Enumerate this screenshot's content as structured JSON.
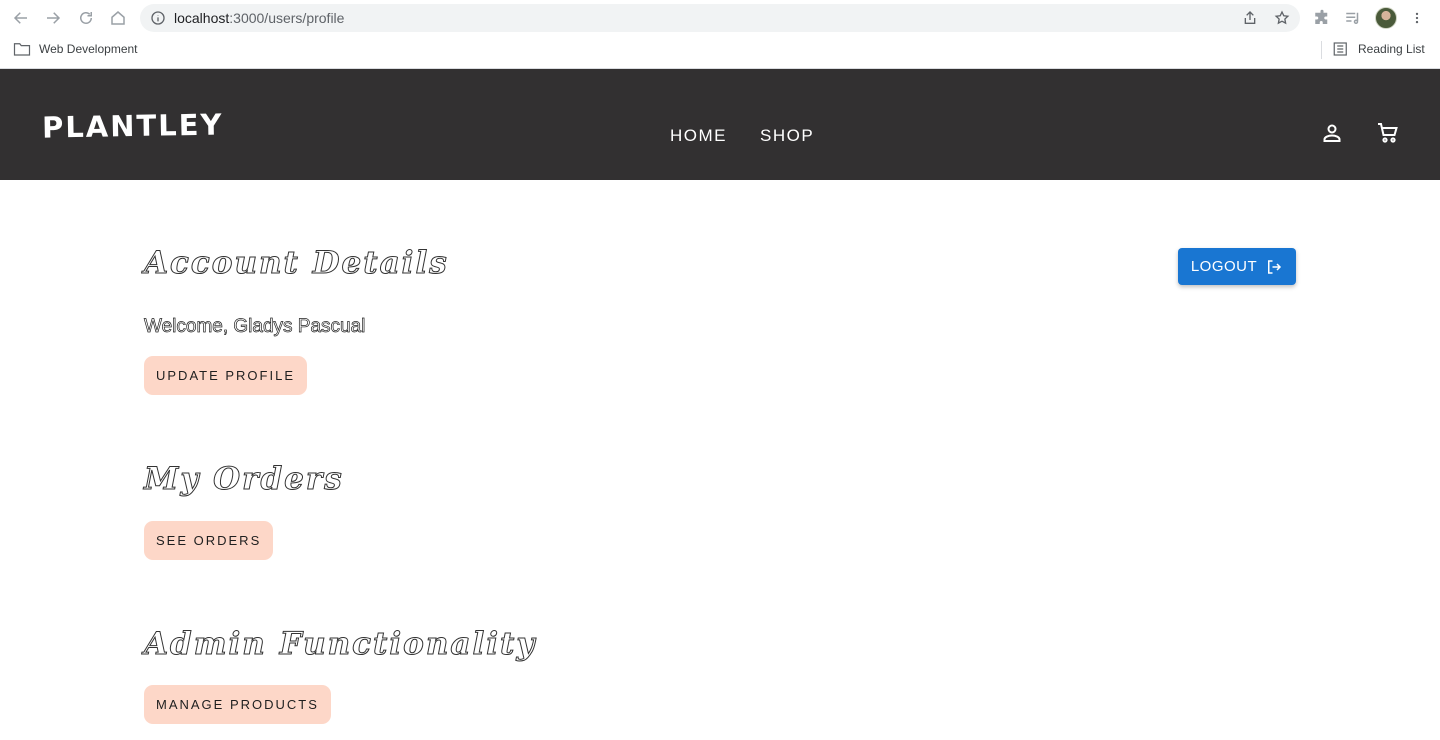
{
  "browser": {
    "url_host": "localhost",
    "url_path": ":3000/users/profile",
    "bookmarks": {
      "web_development": "Web Development",
      "reading_list": "Reading List"
    }
  },
  "header": {
    "logo": "PLANTLEY",
    "nav": {
      "home": "HOME",
      "shop": "SHOP"
    },
    "icons": [
      "user-icon",
      "cart-icon"
    ]
  },
  "account": {
    "title": "Account Details",
    "welcome": "Welcome, Gladys Pascual",
    "update_profile": "UPDATE PROFILE",
    "logout": "LOGOUT"
  },
  "orders": {
    "title": "My Orders",
    "see_orders": "SEE ORDERS"
  },
  "admin": {
    "title": "Admin Functionality",
    "manage_products": "MANAGE PRODUCTS"
  },
  "colors": {
    "header_bg": "#323031",
    "pill_button_bg": "#fdd7c8",
    "logout_bg": "#1976d2"
  }
}
